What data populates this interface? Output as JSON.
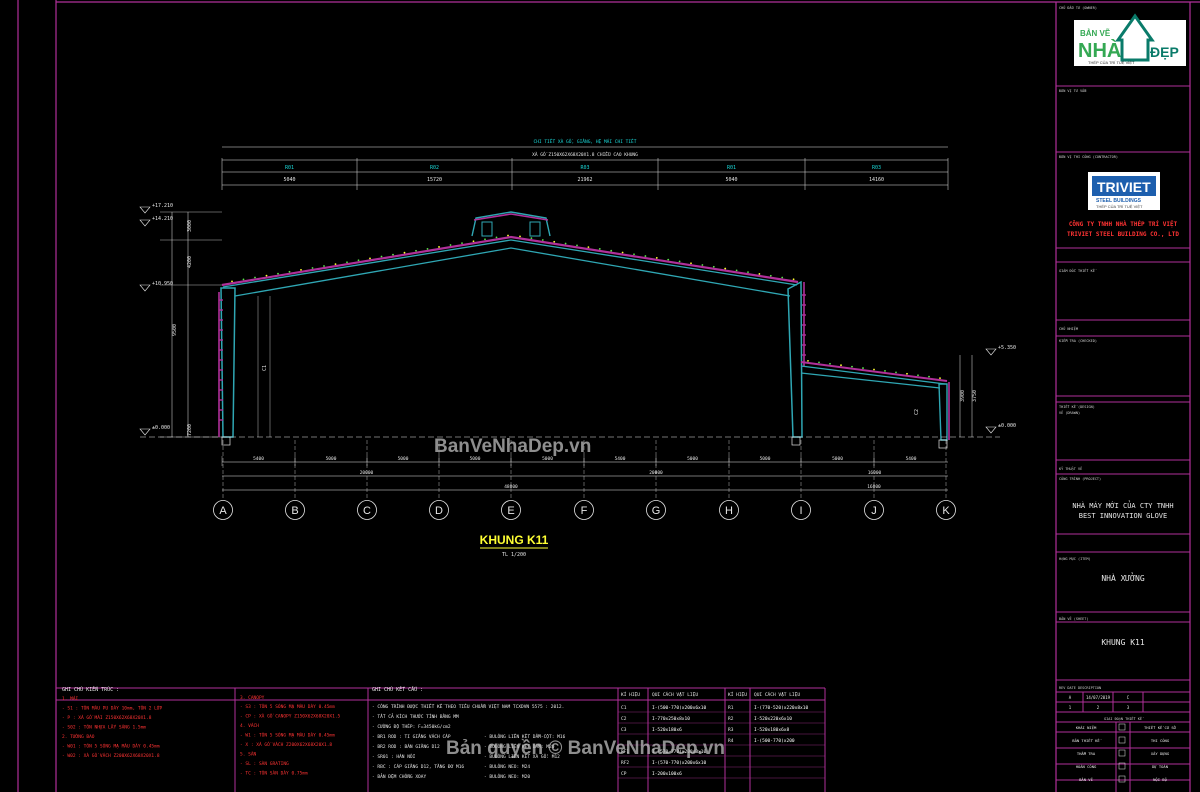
{
  "drawing": {
    "title": "KHUNG K11",
    "scale": "TL 1/200",
    "top_note_1": "CHI TIẾT XÀ GỒ, GIẰNG, HỆ MÁI CHI TIẾT",
    "top_note_2": "XÀ GỒ Z150X62X68X20X1.8 CHIỀU CAO KHUNG",
    "segment_marks": [
      "R01",
      "R02",
      "R03",
      "R01",
      "R03"
    ],
    "segment_dims": [
      "5040",
      "15720",
      "21962",
      "5040",
      "14160"
    ],
    "level_labels_left": [
      "+17.210",
      "+14.210",
      "+10.950",
      "±0.000"
    ],
    "level_labels_right": [
      "+5.350",
      "±0.000"
    ],
    "vertical_dims_left": [
      "3000",
      "4200",
      "9500",
      "7200"
    ],
    "vertical_dims_right": [
      "3900",
      "3750"
    ],
    "bay_dims": [
      "5400",
      "5000",
      "5000",
      "5000",
      "5000",
      "5400",
      "5000",
      "5000",
      "5000",
      "5400"
    ],
    "span_dims": [
      "20000",
      "20000",
      "16000"
    ],
    "overall_dim": "48000",
    "right_overall_dim": "16000",
    "grid_axes": [
      "A",
      "B",
      "C",
      "D",
      "E",
      "F",
      "G",
      "H",
      "I",
      "K",
      "J"
    ],
    "column_tags": [
      "C1",
      "C2",
      "C1"
    ]
  },
  "notes": {
    "arch_header": "GHI CHÚ KIẾN TRÚC :",
    "arch_lines": [
      "1. MÁI",
      "- S1 : TÔN MÀU PU DÀY 10mm, TÔN 2 LỚP",
      "- P : XÀ GỒ MÁI Z150X62X68X20X1.8",
      "- S02 : TÔN NHỰA LẤY SÁNG 1.5mm",
      "2. TƯỜNG BAO",
      "- W01 : TÔN 5 SÓNG MẠ MÀU DÀY 0.45mm",
      "- W02 : XÀ GỒ VÁCH Z200X62X68X20X1.8"
    ],
    "canopy_header": "3. CANOPY",
    "canopy_lines": [
      "- S3 : TÔN 5 SÓNG MẠ MÀU DÀY 0.45mm",
      "- CP : XÀ GỒ CANOPY Z150X62X68X20X1.5",
      "4. VÁCH",
      "- W1 : TÔN 5 SÓNG MẠ MÀU DÀY 0.45mm",
      "- X : XÀ GỒ VÁCH Z200X62X68X20X1.8",
      "5. SÀN",
      "- SL : SÀN GRATING",
      "- TC : TÔN SÀN DÀY 0.75mm"
    ],
    "struct_header": "GHI CHÚ KẾT CẤU :",
    "struct_lines": [
      "- CÔNG TRÌNH ĐƯỢC THIẾT KẾ THEO TIÊU CHUẨN VIỆT NAM TCXDVN 5575 : 2012.",
      "- TẤT CẢ KÍCH THƯỚC TÍNH BẰNG MM",
      "- CƯỜNG ĐỘ THÉP: F=3450kG/cm2",
      "- BR1 ROD : TI GIẰNG VÁCH CÁP",
      "- BR2 ROD : BÁN GIẰNG D12",
      "- SR01 : HÀN NỐI",
      "- RBC : CÁP GIẰNG D12, TĂNG ĐƠ M16",
      "- BẢN ĐỆM CHỐNG XOAY"
    ],
    "struct_lines_b": [
      "- BULÔNG LIÊN KẾT DẦM-CỘT: M16",
      "- BULÔNG LIÊN KẾT DẦM: M20",
      "- BULÔNG LIÊN KẾT XÀ GỒ: M12",
      "- BULÔNG NEO: M24",
      "- BULÔNG NEO: M20"
    ],
    "member_table": {
      "headers": [
        "KÍ HIỆU",
        "QUI CÁCH VẬT LIỆU",
        "KÍ HIỆU",
        "QUI CÁCH VẬT LIỆU"
      ],
      "rows": [
        [
          "C1",
          "I-(500-770)x200x6x10",
          "R1",
          "I-(770-520)x220x8x10"
        ],
        [
          "C2",
          "I-770x250x8x10",
          "R2",
          "I-520x220x6x10"
        ],
        [
          "C3",
          "I-520x180x6",
          "R3",
          "I-520x180x6x8"
        ],
        [
          "",
          "",
          "R4",
          "I-(500-770)x200"
        ],
        [
          "RF1",
          "I-(570-770)x200x8x10",
          "",
          ""
        ],
        [
          "RF2",
          "I-(570-770)x200x6x10",
          "",
          ""
        ],
        [
          "CP",
          "I-200x100x6",
          "",
          ""
        ]
      ]
    }
  },
  "title_block": {
    "label_owner": "CHỦ ĐẦU TƯ (OWNER)",
    "logo_text_1": "BẢN VẼ",
    "logo_text_2": "NHÀ",
    "logo_text_3": "ĐẸP",
    "logo_slogan": "THÉP CỦA TRÍ TUỆ VIỆT",
    "label_consultant": "ĐƠN VỊ TƯ VẤN",
    "label_contractor": "ĐƠN VỊ THI CÔNG (CONTRACTOR)",
    "company_logo_1": "TRIVIET",
    "company_logo_2": "STEEL BUILDINGS",
    "company_slogan": "THÉP CỦA TRÍ TUỆ VIỆT",
    "company_name_1": "CÔNG TY TNHH NHÀ THÉP TRÍ VIỆT",
    "company_name_2": "TRIVIET STEEL BUILDING CO., LTD",
    "label_design_director": "GIÁM ĐỐC THIẾT KẾ",
    "label_manager": "CHỦ NHIỆM",
    "label_checked": "KIỂM TRA (CHECKED)",
    "label_design": "THIẾT KẾ (DESIGN)",
    "label_drawn": "VẼ (DRAWN)",
    "label_drafter": "KỸ THUẬT VẼ",
    "label_project": "CÔNG TRÌNH (PROJECT)",
    "project_1": "NHÀ MÁY MỚI CỦA CTY TNHH",
    "project_2": "BEST INNOVATION GLOVE",
    "label_item": "HẠNG MỤC (ITEM)",
    "item_value": "NHÀ XƯỞNG",
    "label_sheet": "BẢN VẼ (SHEET)",
    "sheet_value": "KHUNG K11",
    "rev_header": "REV DATE DESCRIPTION",
    "rev_rows": [
      [
        "A",
        "14/07/2019",
        "C"
      ],
      [
        "1",
        "2",
        "3"
      ]
    ],
    "stage_header": "GIAI ĐOẠN THIẾT KẾ",
    "stage_rows": [
      [
        "KHÁI NIỆM",
        "THIẾT KẾ CƠ SỞ"
      ],
      [
        "BẢN THIẾT KẾ",
        "THI CÔNG"
      ],
      [
        "THẨM TRA",
        "XÂY DỰNG"
      ],
      [
        "HOÀN CÔNG",
        "DỰ TOÁN"
      ],
      [
        "BẢN VẼ",
        "NỘI BỘ"
      ]
    ]
  },
  "watermarks": [
    "BanVeNhaDep.vn",
    "Bản quyền © BanVeNhaDep.vn"
  ],
  "colors": {
    "background": "#000000",
    "magenta": "#b0309a",
    "cyan": "#1ad8d8",
    "teal": "#2fa7b4",
    "red": "#ff3333",
    "yellow": "#ffff33",
    "white": "#e6e6e6",
    "frame": "#c02fa8"
  }
}
